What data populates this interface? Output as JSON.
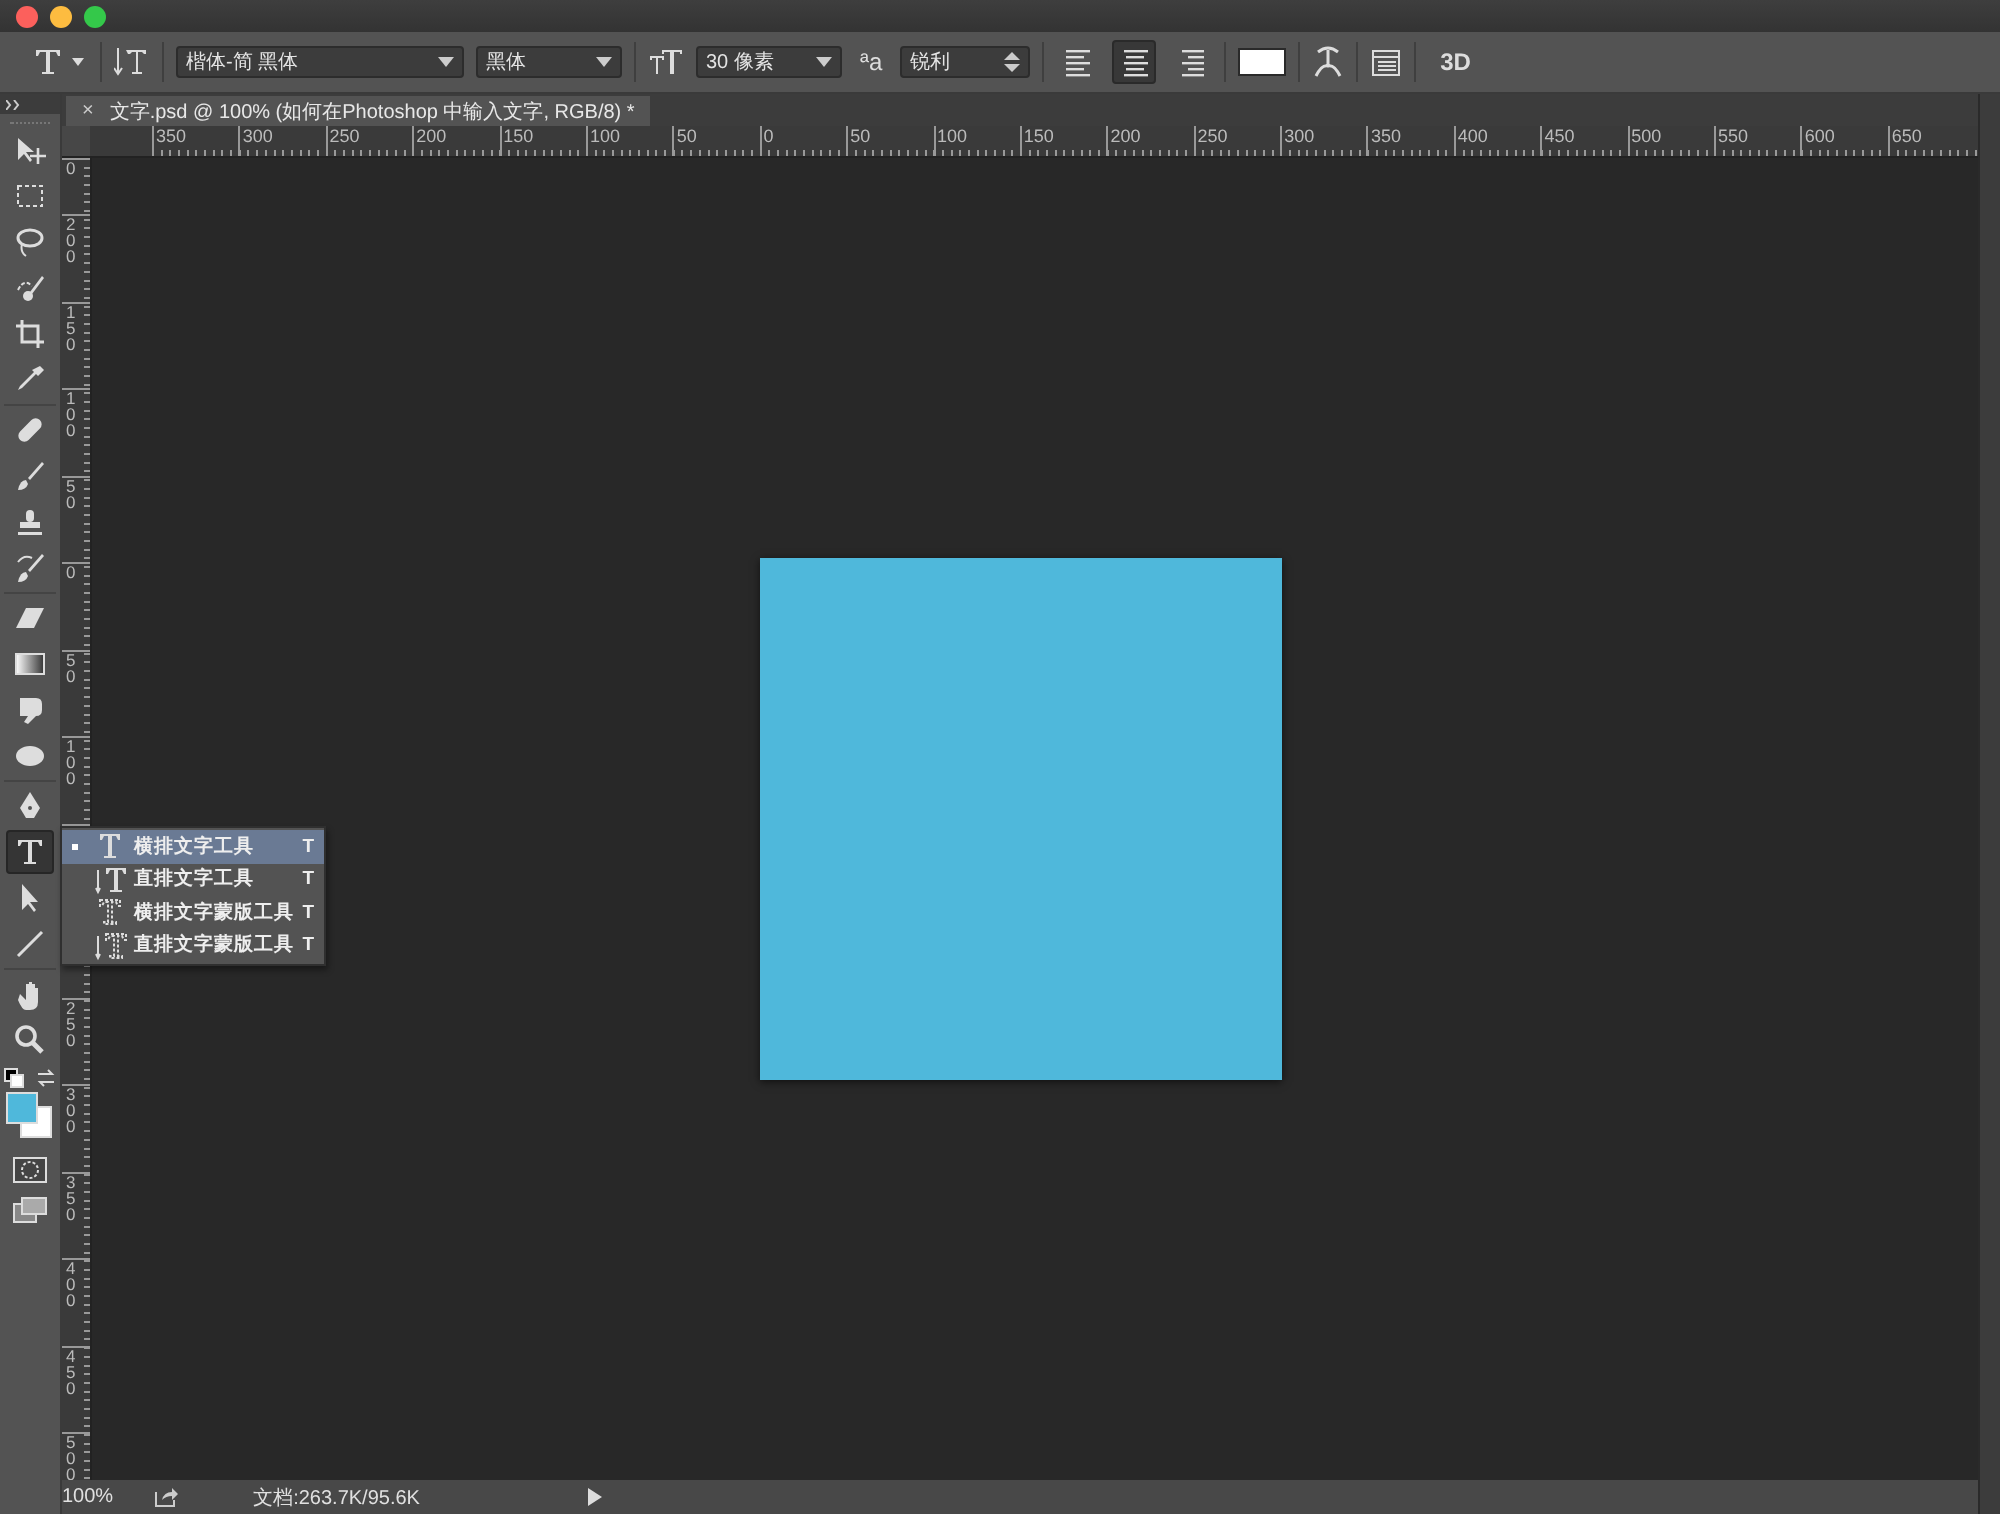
{
  "options_bar": {
    "font_family": "楷体-简 黑体",
    "font_style": "黑体",
    "font_size": "30 像素",
    "antialias_icon": "ªa",
    "antialias": "锐利",
    "alignment": [
      {
        "kind": "left",
        "selected": false
      },
      {
        "kind": "center",
        "selected": true
      },
      {
        "kind": "right",
        "selected": false
      }
    ],
    "threed": "3D"
  },
  "document_tab": {
    "close": "×",
    "title": "文字.psd @ 100% (如何在Photoshop 中输入文字, RGB/8) *"
  },
  "horizontal_ruler": [
    "350",
    "300",
    "250",
    "200",
    "150",
    "100",
    "50",
    "0",
    "50",
    "100",
    "150",
    "200",
    "250",
    "300",
    "350",
    "400",
    "450",
    "500",
    "550",
    "600",
    "650"
  ],
  "vertical_ruler": {
    "upper": [
      "0",
      "200",
      "150",
      "100",
      "50",
      "0",
      "50",
      "100"
    ],
    "lower": [
      "250",
      "300",
      "350",
      "400",
      "450",
      "500"
    ]
  },
  "tools": [
    {
      "kind": "move",
      "selected": false
    },
    {
      "kind": "marquee",
      "selected": false
    },
    {
      "kind": "lasso",
      "selected": false
    },
    {
      "kind": "quick",
      "selected": false
    },
    {
      "kind": "crop",
      "selected": false
    },
    {
      "kind": "eyedropper",
      "selected": false
    },
    {
      "kind": "heal",
      "selected": false
    },
    {
      "kind": "brush",
      "selected": false
    },
    {
      "kind": "stamp",
      "selected": false
    },
    {
      "kind": "history",
      "selected": false
    },
    {
      "kind": "eraser",
      "selected": false
    },
    {
      "kind": "gradient",
      "selected": false
    },
    {
      "kind": "smudge",
      "selected": false
    },
    {
      "kind": "sponge",
      "selected": false
    },
    {
      "kind": "pen",
      "selected": false
    },
    {
      "kind": "type",
      "selected": true
    },
    {
      "kind": "select",
      "selected": false
    },
    {
      "kind": "line",
      "selected": false
    },
    {
      "kind": "hand",
      "selected": false
    },
    {
      "kind": "zoom",
      "selected": false
    }
  ],
  "type_flyout": [
    {
      "kind": "h",
      "label": "横排文字工具",
      "shortcut": "T",
      "selected": true
    },
    {
      "kind": "v",
      "label": "直排文字工具",
      "shortcut": "T",
      "selected": false
    },
    {
      "kind": "hm",
      "label": "横排文字蒙版工具",
      "shortcut": "T",
      "selected": false
    },
    {
      "kind": "vm",
      "label": "直排文字蒙版工具",
      "shortcut": "T",
      "selected": false
    }
  ],
  "status_bar": {
    "zoom": "100%",
    "doc": "文档:263.7K/95.6K"
  }
}
